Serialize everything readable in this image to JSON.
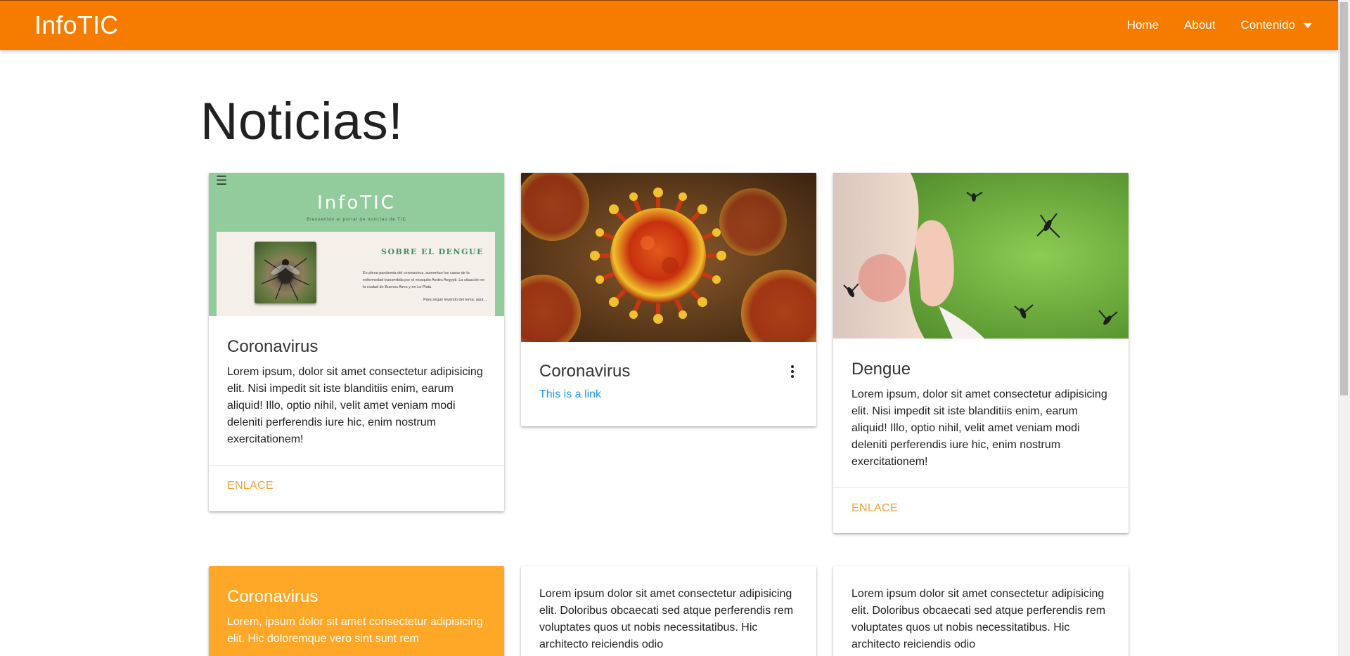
{
  "navbar": {
    "brand": "InfoTIC",
    "links": [
      "Home",
      "About",
      "Contenido"
    ],
    "color": "#f57c00"
  },
  "main": {
    "title": "Noticias!",
    "cards": [
      {
        "title": "Coronavirus",
        "text": "Lorem ipsum, dolor sit amet consectetur adipisicing elit. Nisi impedit sit iste blanditiis enim, earum aliquid! Illo, optio nihil, velit amet veniam modi deleniti perferendis iure hic, enim nostrum exercitationem!",
        "action": "Enlace",
        "image": {
          "title": "InfoTIC",
          "subtitle": "Bienvenido al portal de noticias de TIC",
          "panel_title": "SOBRE EL DENGUE",
          "panel_text": "En plena pandemia del coronavirus, aumentan los casos de la enfermedad transmitida por el mosquito Aedes Aegypti. La situación en la ciudad de Buenos Aires y en La Plata",
          "panel_more": "Para seguir leyendo del tema, aquí..."
        }
      },
      {
        "title": "Coronavirus",
        "link": "This is a link",
        "menu_icon": "more-vert-icon"
      },
      {
        "title": "Dengue",
        "text": "Lorem ipsum, dolor sit amet consectetur adipisicing elit. Nisi impedit sit iste blanditiis enim, earum aliquid! Illo, optio nihil, velit amet veniam modi deleniti perferendis iure hic, enim nostrum exercitationem!",
        "action": "Enlace"
      },
      {
        "title": "Coronavirus",
        "text": "Lorem, ipsum dolor sit amet consectetur adipisicing elit. Hic doloremque vero sint sunt rem",
        "color": "#ffa726"
      },
      {
        "text": "Lorem ipsum dolor sit amet consectetur adipisicing elit. Doloribus obcaecati sed atque perferendis rem voluptates quos ut nobis necessitatibus. Hic architecto reiciendis odio"
      },
      {
        "text": "Lorem ipsum dolor sit amet consectetur adipisicing elit. Doloribus obcaecati sed atque perferendis rem voluptates quos ut nobis necessitatibus. Hic architecto reiciendis odio"
      }
    ]
  }
}
